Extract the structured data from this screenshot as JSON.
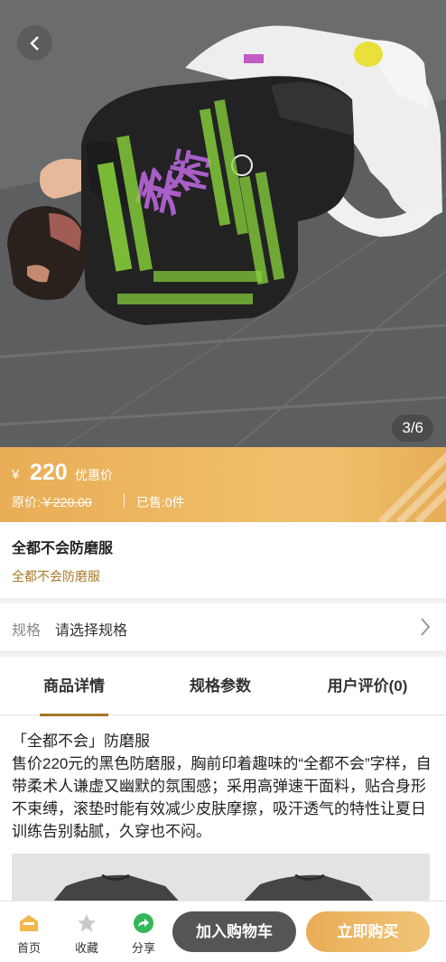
{
  "gallery": {
    "counter": "3/6",
    "shirt_print_chars": [
      "柔",
      "術"
    ]
  },
  "price": {
    "currency": "¥",
    "value": "220",
    "tag": "优惠价",
    "original_label": "原价:",
    "original_value": "￥220.00",
    "sold_label": "已售:",
    "sold_value": "0件"
  },
  "product": {
    "name": "全都不会防磨服",
    "subtitle": "全都不会防磨服"
  },
  "spec": {
    "label": "规格",
    "value": "请选择规格"
  },
  "tabs": [
    {
      "label": "商品详情",
      "active": true
    },
    {
      "label": "规格参数",
      "active": false
    },
    {
      "label": "用户评价(0)",
      "active": false
    }
  ],
  "description": {
    "heading": "「全都不会」防磨服",
    "body": "售价220元的黑色防磨服，胸前印着趣味的“全都不会”字样，自带柔术人谦虚又幽默的氛围感；采用高弹速干面料，贴合身形不束缚，滚垫时能有效减少皮肤摩擦，吸汗透气的特性让夏日训练告别黏腻，久穿也不闷。"
  },
  "bottom_nav": {
    "home": "首页",
    "favorite": "收藏",
    "share": "分享",
    "add_to_cart": "加入购物车",
    "buy_now": "立即购买"
  },
  "colors": {
    "accent_gold": "#e9ad57",
    "brown_text": "#a8792c",
    "dark_button": "#555555",
    "print_purple": "#a95ec8",
    "print_green": "#89d53b"
  }
}
